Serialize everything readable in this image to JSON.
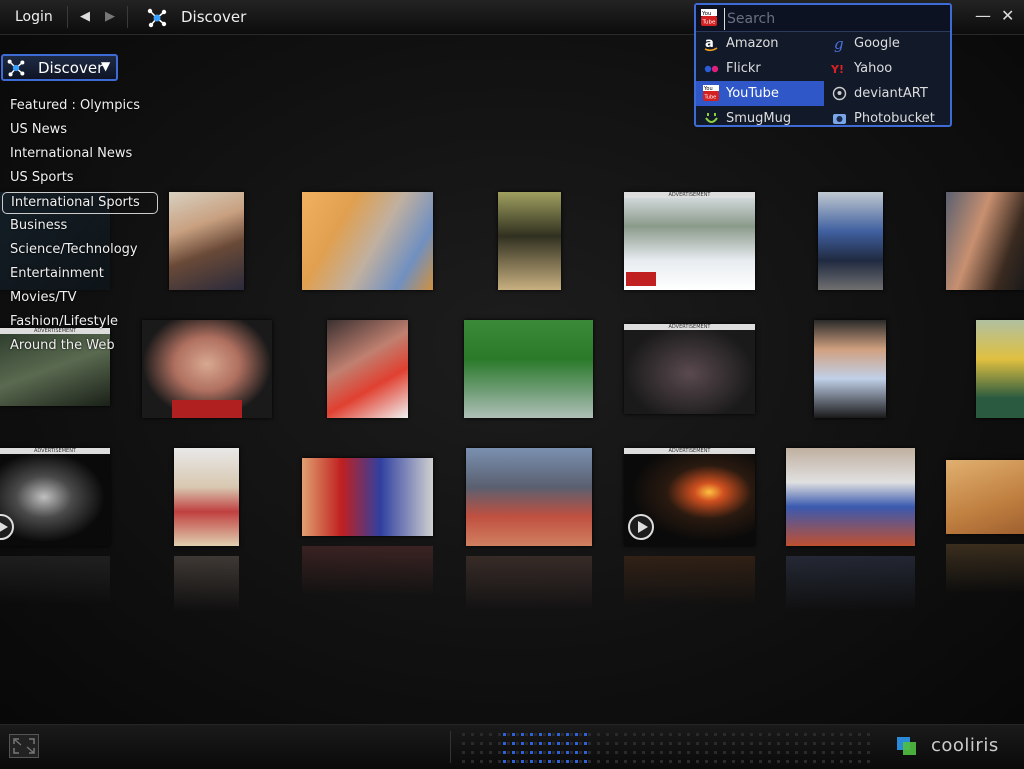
{
  "topbar": {
    "login_label": "Login",
    "back_arrow": "◀",
    "forward_arrow": "▶",
    "title": "Discover",
    "minimize_glyph": "—",
    "close_glyph": "✕"
  },
  "search": {
    "placeholder": "Search",
    "value": "",
    "providers": [
      {
        "label": "Amazon",
        "icon": "amazon-icon"
      },
      {
        "label": "Google",
        "icon": "google-icon"
      },
      {
        "label": "Flickr",
        "icon": "flickr-icon"
      },
      {
        "label": "Yahoo",
        "icon": "yahoo-icon"
      },
      {
        "label": "YouTube",
        "icon": "youtube-icon",
        "selected": true
      },
      {
        "label": "deviantART",
        "icon": "deviantart-icon"
      },
      {
        "label": "SmugMug",
        "icon": "smugmug-icon"
      },
      {
        "label": "Photobucket",
        "icon": "photobucket-icon"
      }
    ]
  },
  "discover_dropdown": {
    "label": "Discover",
    "caret": "▼"
  },
  "categories": [
    {
      "label": "Featured : Olympics"
    },
    {
      "label": "US News"
    },
    {
      "label": "International News"
    },
    {
      "label": "US Sports"
    },
    {
      "label": "International Sports",
      "selected": true
    },
    {
      "label": "Business"
    },
    {
      "label": "Science/Technology"
    },
    {
      "label": "Entertainment"
    },
    {
      "label": "Movies/TV"
    },
    {
      "label": "Fashion/Lifestyle"
    },
    {
      "label": "Around the Web"
    }
  ],
  "ad_tag": "ADVERTISEMENT",
  "brand": {
    "name": "cooliris",
    "accent": "#3f6bd6"
  }
}
